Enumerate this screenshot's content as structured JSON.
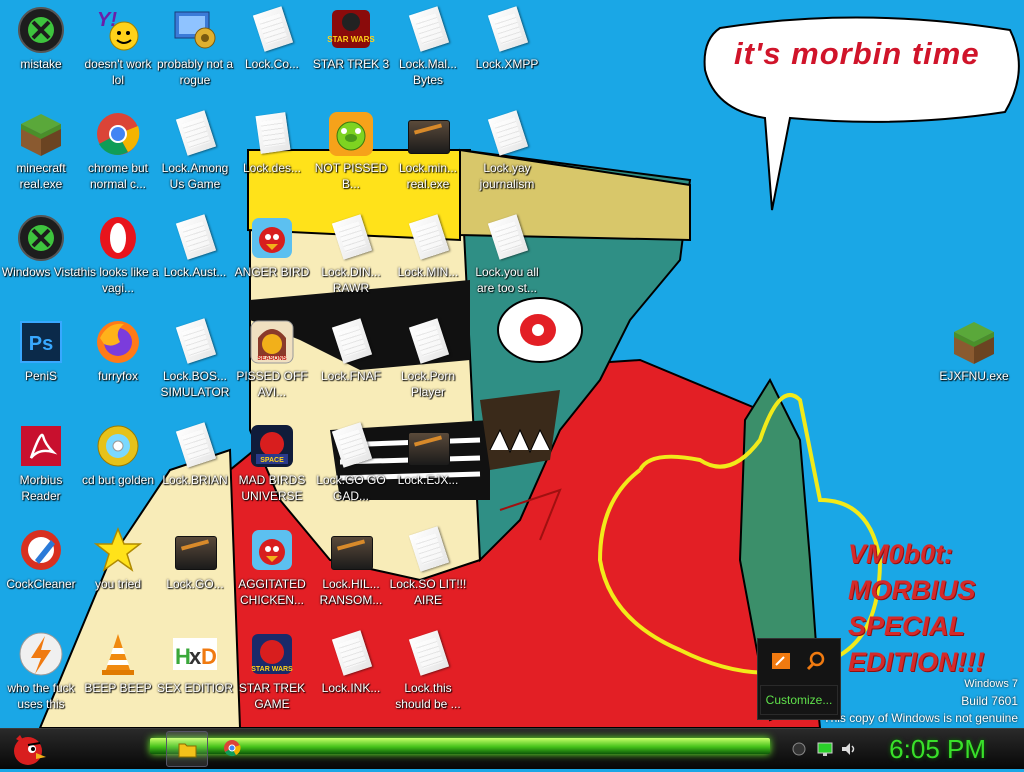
{
  "desktop": {
    "icons": [
      {
        "label": "mistake",
        "icon": "xbox-orb-icon"
      },
      {
        "label": "doesn't work lol",
        "icon": "yahoo-messenger-icon"
      },
      {
        "label": "probably not a rogue",
        "icon": "control-panel-icon"
      },
      {
        "label": "Lock.Co...",
        "icon": "document-icon"
      },
      {
        "label": "STAR TREK 3",
        "icon": "star-wars-game-icon"
      },
      {
        "label": "Lock.Mal... Bytes",
        "icon": "document-icon"
      },
      {
        "label": "Lock.XMPP",
        "icon": "document-icon"
      },
      {
        "label": "minecraft real.exe",
        "icon": "minecraft-grass-icon"
      },
      {
        "label": "chrome but normal c...",
        "icon": "chrome-icon"
      },
      {
        "label": "Lock.Among Us Game",
        "icon": "document-icon"
      },
      {
        "label": "Lock.des...",
        "icon": "text-document-icon"
      },
      {
        "label": "NOT PISSED B...",
        "icon": "bad-piggies-icon"
      },
      {
        "label": "Lock.min... real.exe",
        "icon": "dark-exe-icon"
      },
      {
        "label": "Lock.yay journalism",
        "icon": "document-icon"
      },
      {
        "label": "Windows Vista",
        "icon": "xbox-orb-icon"
      },
      {
        "label": "this looks like a vagi...",
        "icon": "opera-icon"
      },
      {
        "label": "Lock.Aust...",
        "icon": "document-icon"
      },
      {
        "label": "ANGER BIRD",
        "icon": "angry-birds-icon"
      },
      {
        "label": "Lock.DIN... RAWR",
        "icon": "document-icon"
      },
      {
        "label": "Lock.MIN...",
        "icon": "document-icon"
      },
      {
        "label": "Lock.you all are too st...",
        "icon": "document-icon"
      },
      {
        "label": "PeniS",
        "icon": "photoshop-icon"
      },
      {
        "label": "furryfox",
        "icon": "firefox-icon"
      },
      {
        "label": "Lock.BOS... SIMULATOR",
        "icon": "document-icon"
      },
      {
        "label": "PISSED OFF AVI...",
        "icon": "angry-birds-seasons-icon"
      },
      {
        "label": "Lock.FNAF",
        "icon": "document-icon"
      },
      {
        "label": "Lock.Porn Player",
        "icon": "document-icon"
      },
      {
        "label": "Morbius Reader",
        "icon": "pdf-reader-icon"
      },
      {
        "label": "cd but golden",
        "icon": "gold-cd-icon"
      },
      {
        "label": "Lock.BRIAN",
        "icon": "document-icon"
      },
      {
        "label": "MAD BIRDS UNIVERSE",
        "icon": "angry-birds-space-icon"
      },
      {
        "label": "Lock.GO GO GAD...",
        "icon": "document-icon"
      },
      {
        "label": "Lock.EJX...",
        "icon": "dark-exe-icon"
      },
      {
        "label": "CockCleaner",
        "icon": "ccleaner-icon"
      },
      {
        "label": "you tried",
        "icon": "gold-star-icon"
      },
      {
        "label": "Lock.GO...",
        "icon": "dark-exe-icon"
      },
      {
        "label": "AGGITATED CHICKEN...",
        "icon": "angry-birds-icon"
      },
      {
        "label": "Lock.HIL... RANSOM...",
        "icon": "dark-exe-icon"
      },
      {
        "label": "Lock.SO LIT!!! AIRE",
        "icon": "document-icon"
      },
      {
        "label": "who the fuck uses this",
        "icon": "winamp-bolt-icon"
      },
      {
        "label": "BEEP BEEP",
        "icon": "vlc-cone-icon"
      },
      {
        "label": "SEX EDITIOR",
        "icon": "hxd-editor-icon"
      },
      {
        "label": "STAR TREK GAME",
        "icon": "star-wars-birds-icon"
      },
      {
        "label": "Lock.INK...",
        "icon": "document-icon"
      },
      {
        "label": "Lock.this should be ...",
        "icon": "document-icon"
      },
      {
        "label": "EJXFNU.exe",
        "icon": "minecraft-grass-icon"
      }
    ]
  },
  "wallpaper": {
    "speech_text": "it's morbin time",
    "edition_text": "VM0b0t: MORBIUS SPECIAL EDITION!!!"
  },
  "watermark": {
    "line1": "Windows 7",
    "line2": "Build 7601",
    "line3": "This copy of Windows is not genuine"
  },
  "tray_popup": {
    "customize_label": "Customize..."
  },
  "taskbar": {
    "clock": "6:05 PM",
    "start_icon": "angry-bird-orb-icon",
    "buttons": [
      {
        "name": "explorer-taskbar-button",
        "icon": "folder-icon"
      },
      {
        "name": "chrome-taskbar-button",
        "icon": "chrome-icon"
      }
    ]
  },
  "colors": {
    "desktop_bg": "#1aa7e6",
    "clock_green": "#39e02a",
    "taskbar_glow": "#45c21a",
    "edition_red": "#d42a2a"
  }
}
